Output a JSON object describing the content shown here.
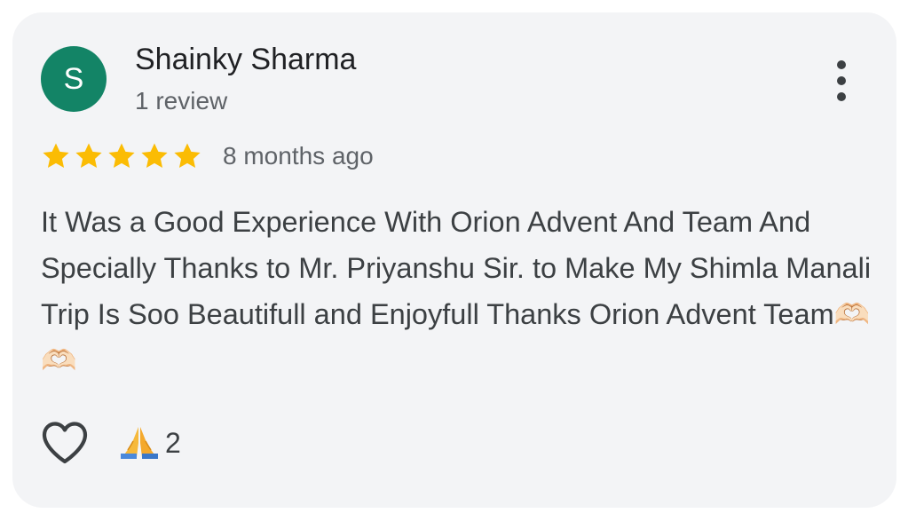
{
  "reviewer": {
    "avatar_letter": "S",
    "avatar_color": "#138466",
    "name": "Shainky Sharma",
    "review_count": "1 review"
  },
  "review": {
    "rating": 5,
    "rating_max": 5,
    "star_color": "#fbbc04",
    "time_ago": "8 months ago",
    "text": "It Was a Good Experience With Orion Advent And Team And Specially Thanks to Mr. Priyanshu Sir. to Make My Shimla Manali Trip Is Soo Beautifull and Enjoyfull Thanks Orion Advent Team🫶🏻🫶🏻"
  },
  "actions": {
    "like_icon": "heart-outline-icon",
    "reaction_icon": "folded-hands-emoji",
    "reaction_count": "2"
  },
  "menu": {
    "icon": "more-vert-icon"
  }
}
